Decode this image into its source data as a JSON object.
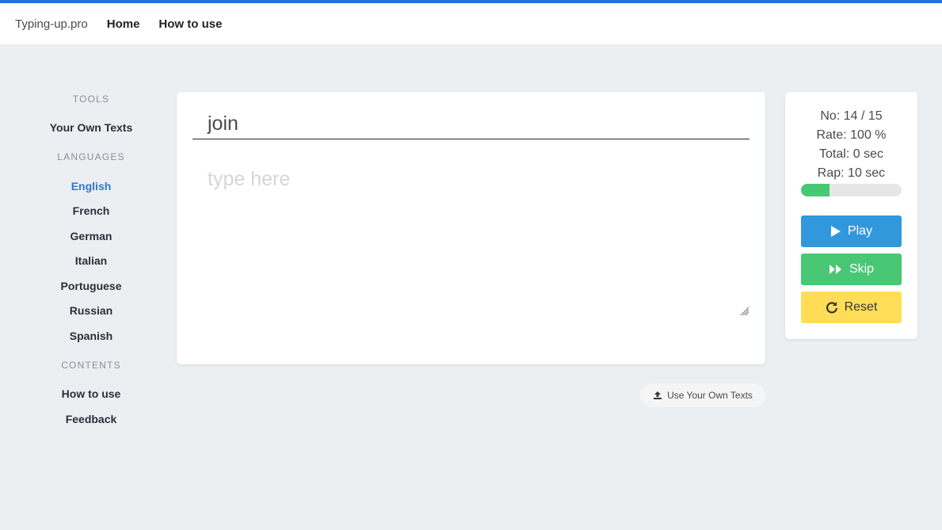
{
  "navbar": {
    "brand": "Typing-up.pro",
    "links": [
      "Home",
      "How to use"
    ]
  },
  "sidebar": {
    "tools_heading": "TOOLS",
    "tools": [
      "Your Own Texts"
    ],
    "languages_heading": "LANGUAGES",
    "languages": [
      "English",
      "French",
      "German",
      "Italian",
      "Portuguese",
      "Russian",
      "Spanish"
    ],
    "active_language": "English",
    "contents_heading": "CONTENTS",
    "contents": [
      "How to use",
      "Feedback"
    ]
  },
  "typing": {
    "target_word": "join",
    "input_value": "",
    "input_placeholder": "type here"
  },
  "upload_button_label": "Use Your Own Texts",
  "stats": {
    "number": "No: 14 / 15",
    "rate": "Rate: 100 %",
    "total": "Total: 0 sec",
    "rap": "Rap: 10 sec",
    "progress_fraction": 0.28
  },
  "buttons": {
    "play": "Play",
    "skip": "Skip",
    "reset": "Reset"
  },
  "colors": {
    "accent": "#2a6fdb",
    "active_link": "#3273dc",
    "play": "#3298dc",
    "skip": "#48c774",
    "reset": "#ffdd57",
    "progress": "#48c774"
  },
  "icons": {
    "play": "play-icon",
    "skip": "fast-forward-icon",
    "reset": "redo-icon",
    "upload": "upload-icon",
    "resize": "resize-grip-icon"
  }
}
